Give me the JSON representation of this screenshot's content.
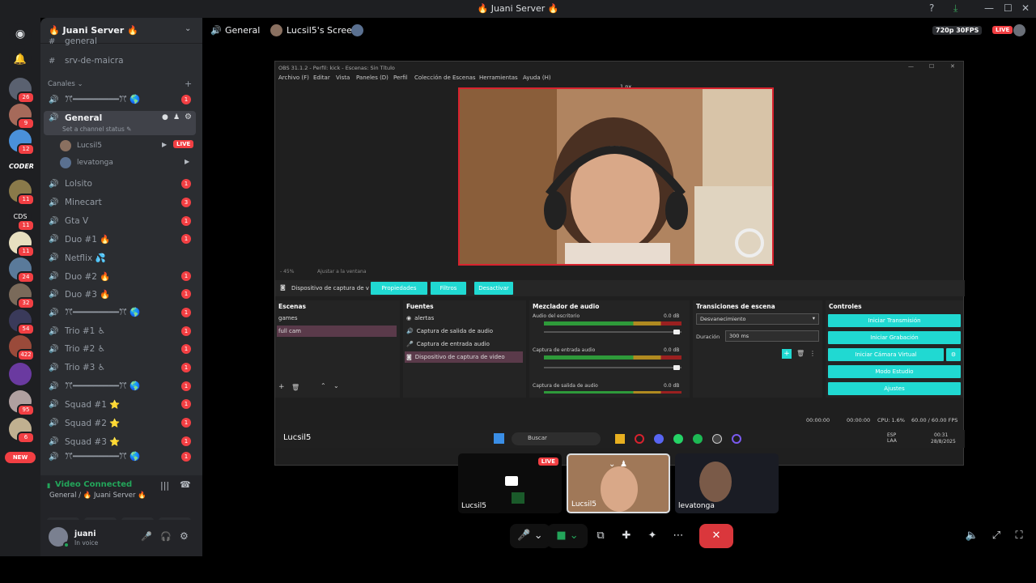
{
  "window": {
    "title": "🔥 Juani Server 🔥",
    "controls": [
      "?",
      "⤓",
      "—",
      "☐",
      "✕"
    ]
  },
  "rail": {
    "badges": [
      "26",
      "9",
      "12",
      "",
      "11",
      "11",
      "11",
      "24",
      "32",
      "54",
      "422",
      "",
      "95",
      "6"
    ],
    "coder_label": "CODER",
    "cds_label": "CDS",
    "new_label": "NEW"
  },
  "sidebar": {
    "server_name": "🔥 Juani Server 🔥",
    "channels_top": [
      {
        "label": "general"
      },
      {
        "label": "srv-de-maicra"
      }
    ],
    "category": "Canales",
    "voice_channels": [
      {
        "label": "ꔫ━━━━━━━━━ꔫ 🌎",
        "mention": "1"
      },
      {
        "label": "General",
        "status": "Set a channel status ✎",
        "mention": "1"
      },
      {
        "label": "Lolsito",
        "mention": "1"
      },
      {
        "label": "Minecart",
        "mention": "3"
      },
      {
        "label": "Gta V",
        "mention": "1"
      },
      {
        "label": "Duo #1 🔥",
        "mention": "1"
      },
      {
        "label": "Netflix 💦",
        "mention": ""
      },
      {
        "label": "Duo #2 🔥",
        "mention": "1"
      },
      {
        "label": "Duo #3 🔥",
        "mention": "1"
      },
      {
        "label": "ꔫ━━━━━━━━━ꔫ 🌎",
        "mention": "1"
      },
      {
        "label": "Trio #1 ♿",
        "mention": "1"
      },
      {
        "label": "Trio #2 ♿",
        "mention": "1"
      },
      {
        "label": "Trio #3 ♿",
        "mention": "1"
      },
      {
        "label": "ꔫ━━━━━━━━━ꔫ 🌎",
        "mention": "1"
      },
      {
        "label": "Squad #1 ⭐",
        "mention": "1"
      },
      {
        "label": "Squad #2 ⭐",
        "mention": "1"
      },
      {
        "label": "Squad #3 ⭐",
        "mention": "1"
      },
      {
        "label": "ꔫ━━━━━━━━━ꔫ 🌎",
        "mention": "1"
      }
    ],
    "users": [
      {
        "name": "Lucsil5",
        "live": "LIVE"
      },
      {
        "name": "levatonga",
        "live": ""
      }
    ]
  },
  "voice_panel": {
    "status": "Video Connected",
    "location": "General / 🔥 Juani Server 🔥",
    "username": "juani",
    "substatus": "In voice"
  },
  "stage": {
    "channel": "General",
    "screen_title": "Lucsil5's Screen",
    "quality": "720p 30FPS",
    "live": "LIVE"
  },
  "obs": {
    "title": "OBS 31.1.2 - Perfil: kick - Escenas: Sin Título",
    "menu": [
      "Archivo (F)",
      "Editar",
      "Vista",
      "Paneles (D)",
      "Perfil",
      "Colección de Escenas",
      "Herramientas",
      "Ayuda (H)"
    ],
    "px_label": "1 px",
    "zoom": "- 45%",
    "fit": "Ajustar a la ventana",
    "source_bar": {
      "label": "Dispositivo de captura de v",
      "props": "Propiedades",
      "filters": "Filtros",
      "deactivate": "Desactivar"
    },
    "scenes": {
      "title": "Escenas",
      "items": [
        "games",
        "full cam"
      ]
    },
    "sources": {
      "title": "Fuentes",
      "items": [
        "alertas",
        "Captura de salida de audio",
        "Captura de entrada audio",
        "Dispositivo de captura de video"
      ]
    },
    "mixer": {
      "title": "Mezclador de audio",
      "channels": [
        {
          "name": "Audio del escritorio",
          "db": "0.0 dB"
        },
        {
          "name": "Captura de entrada audio",
          "db": "0.0 dB"
        },
        {
          "name": "Captura de salida de audio",
          "db": "0.0 dB"
        }
      ]
    },
    "transitions": {
      "title": "Transiciones de escena",
      "type": "Desvanecimiento",
      "duration_label": "Duración",
      "duration": "300 ms"
    },
    "controls": {
      "title": "Controles",
      "buttons": [
        "Iniciar Transmisión",
        "Iniciar Grabación",
        "Iniciar Cámara Virtual",
        "Modo Estudio",
        "Ajustes"
      ]
    },
    "status": {
      "t1": "00:00:00",
      "t2": "00:00:00",
      "cpu": "CPU: 1.6%",
      "fps": "60.00 / 60.00 FPS"
    },
    "taskbar": {
      "user": "Lucsil5",
      "search": "Buscar",
      "lang": "ESP LAA",
      "time": "00:31",
      "date": "28/8/2025"
    }
  },
  "tiles": [
    {
      "name": "Lucsil5",
      "live": "LIVE"
    },
    {
      "name": "Lucsil5",
      "live": ""
    },
    {
      "name": "levatonga",
      "live": ""
    }
  ]
}
